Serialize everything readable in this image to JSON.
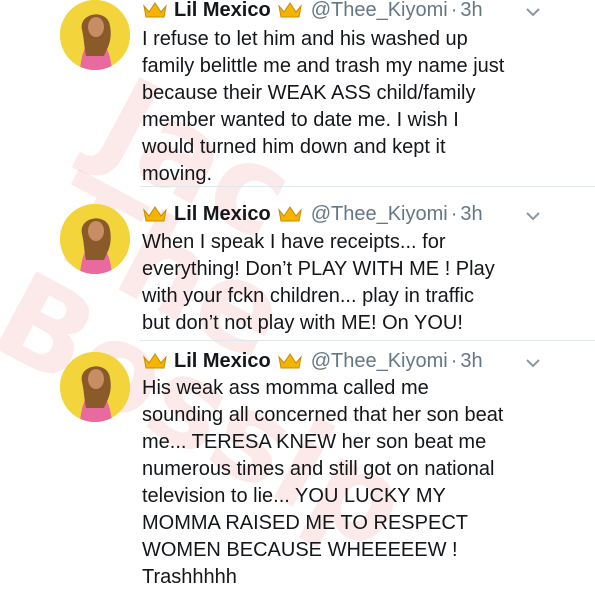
{
  "watermark": "",
  "tweets": [
    {
      "name": "Lil Mexico",
      "handle": "@Thee_Kiyomi",
      "dot": "·",
      "time": "3h",
      "text": "I refuse to let him and his washed up\nfamily belittle me and trash my name just\nbecause their WEAK ASS child/family\nmember wanted to date me. I wish I\nwould turned him down and kept it\nmoving."
    },
    {
      "name": "Lil Mexico",
      "handle": "@Thee_Kiyomi",
      "dot": "·",
      "time": "3h",
      "text": "When I speak I have receipts... for\neverything! Don’t PLAY WITH ME ! Play\nwith your fckn children... play in traffic\nbut don’t not play with ME! On YOU!"
    },
    {
      "name": "Lil Mexico",
      "handle": "@Thee_Kiyomi",
      "dot": "·",
      "time": "3h",
      "text": "His weak ass momma called me\nsounding all concerned that her son beat\nme... TERESA KNEW her son beat me\nnumerous times and still got on national\ntelevision to lie... YOU LUCKY MY\nMOMMA RAISED ME TO RESPECT\nWOMEN BECAUSE WHEEEEEW !\nTrashhhhh"
    }
  ],
  "icons": {
    "crown": "crown-icon",
    "caret": "chevron-down-icon",
    "avatar_bg": "#f3d53b",
    "crown_color": "#f5b400",
    "meta_color": "#657786"
  }
}
